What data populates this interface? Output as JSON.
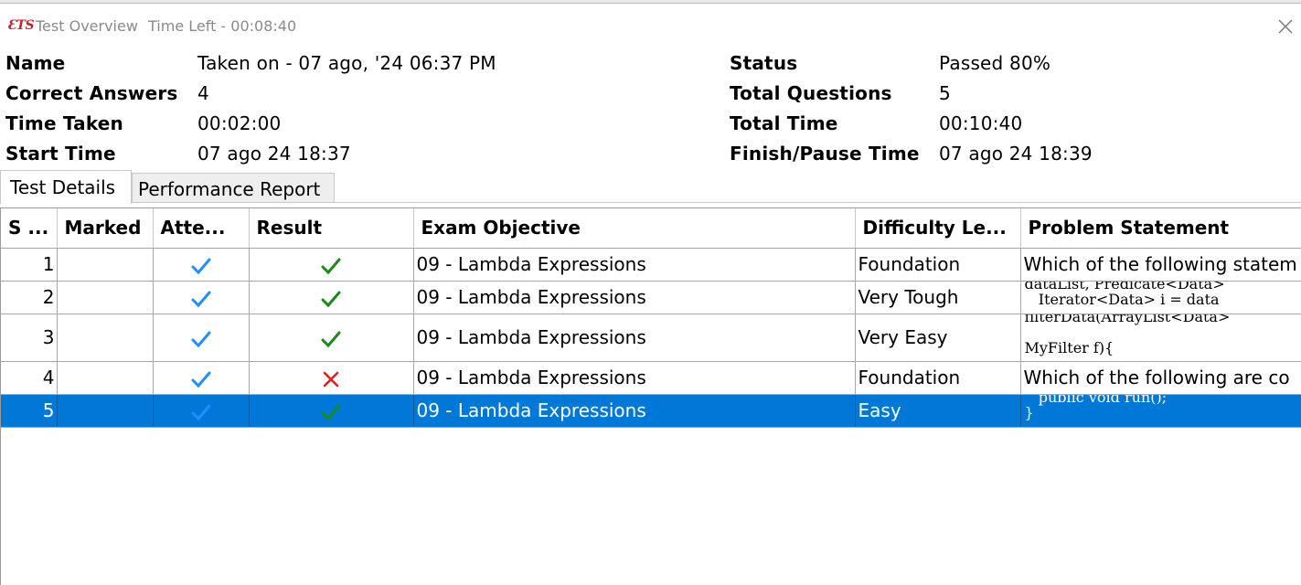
{
  "window": {
    "logo_text": "ETS",
    "title": "Test Overview",
    "time_left": "Time Left - 00:08:40"
  },
  "summary": {
    "name_label": "Name",
    "name_value": "Taken on - 07 ago, '24 06:37 PM",
    "correct_label": "Correct Answers",
    "correct_value": "4",
    "time_taken_label": "Time Taken",
    "time_taken_value": "00:02:00",
    "start_label": "Start Time",
    "start_value": "07 ago 24 18:37",
    "status_label": "Status",
    "status_value": "Passed 80%",
    "total_q_label": "Total Questions",
    "total_q_value": "5",
    "total_time_label": "Total Time",
    "total_time_value": "00:10:40",
    "finish_label": "Finish/Pause Time",
    "finish_value": "07 ago 24 18:39"
  },
  "tabs": [
    {
      "label": "Test Details",
      "active": true
    },
    {
      "label": "Performance Report",
      "active": false
    }
  ],
  "table": {
    "columns": [
      "S ...",
      "Marked",
      "Atte...",
      "Result",
      "Exam Objective",
      "Difficulty Le...",
      "Problem Statement"
    ],
    "rows": [
      {
        "sno": "1",
        "marked": "",
        "attempted": "check",
        "result": "correct",
        "objective": "09 - Lambda Expressions",
        "difficulty": "Foundation",
        "problem": "Which of the following statem"
      },
      {
        "sno": "2",
        "marked": "",
        "attempted": "check",
        "result": "correct",
        "objective": "09 - Lambda Expressions",
        "difficulty": "Very Tough",
        "problem": "dataList, Predicate<Data>\n   Iterator<Data> i = data"
      },
      {
        "sno": "3",
        "marked": "",
        "attempted": "check",
        "result": "correct",
        "objective": "09 - Lambda Expressions",
        "difficulty": "Very Easy",
        "problem": "filterData(ArrayList<Data>\n\nMyFilter f){"
      },
      {
        "sno": "4",
        "marked": "",
        "attempted": "check",
        "result": "wrong",
        "objective": "09 - Lambda Expressions",
        "difficulty": "Foundation",
        "problem": "Which of the following are co"
      },
      {
        "sno": "5",
        "marked": "",
        "attempted": "check",
        "result": "correct",
        "objective": "09 - Lambda Expressions",
        "difficulty": "Easy",
        "problem": "   public void run();\n}",
        "selected": true
      }
    ]
  },
  "colors": {
    "selection": "#0078d7",
    "attempt_check": "#1e90ff",
    "correct_check": "#1a8a1a",
    "wrong_cross": "#e02020",
    "logo": "#c0282d"
  }
}
